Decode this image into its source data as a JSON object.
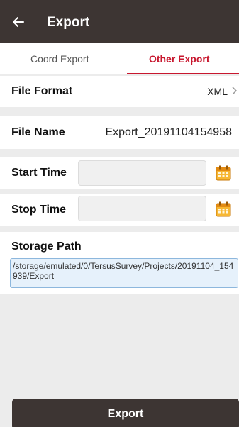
{
  "app_bar": {
    "back_icon": "arrow-left-icon",
    "title": "Export"
  },
  "tabs": [
    {
      "label": "Coord Export",
      "active": false
    },
    {
      "label": "Other Export",
      "active": true
    }
  ],
  "accent_color": "#c8182f",
  "header_color": "#3d3533",
  "file_format": {
    "label": "File Format",
    "value": "XML",
    "chevron_icon": "chevron-right-icon"
  },
  "file_name": {
    "label": "File Name",
    "value": "Export_20191104154958"
  },
  "start_time": {
    "label": "Start Time",
    "value": "",
    "calendar_icon": "calendar-icon"
  },
  "stop_time": {
    "label": "Stop Time",
    "value": "",
    "calendar_icon": "calendar-icon"
  },
  "storage_path": {
    "label": "Storage Path",
    "value": "/storage/emulated/0/TersusSurvey/Projects/20191104_154939/Export"
  },
  "export_button": {
    "label": "Export"
  }
}
